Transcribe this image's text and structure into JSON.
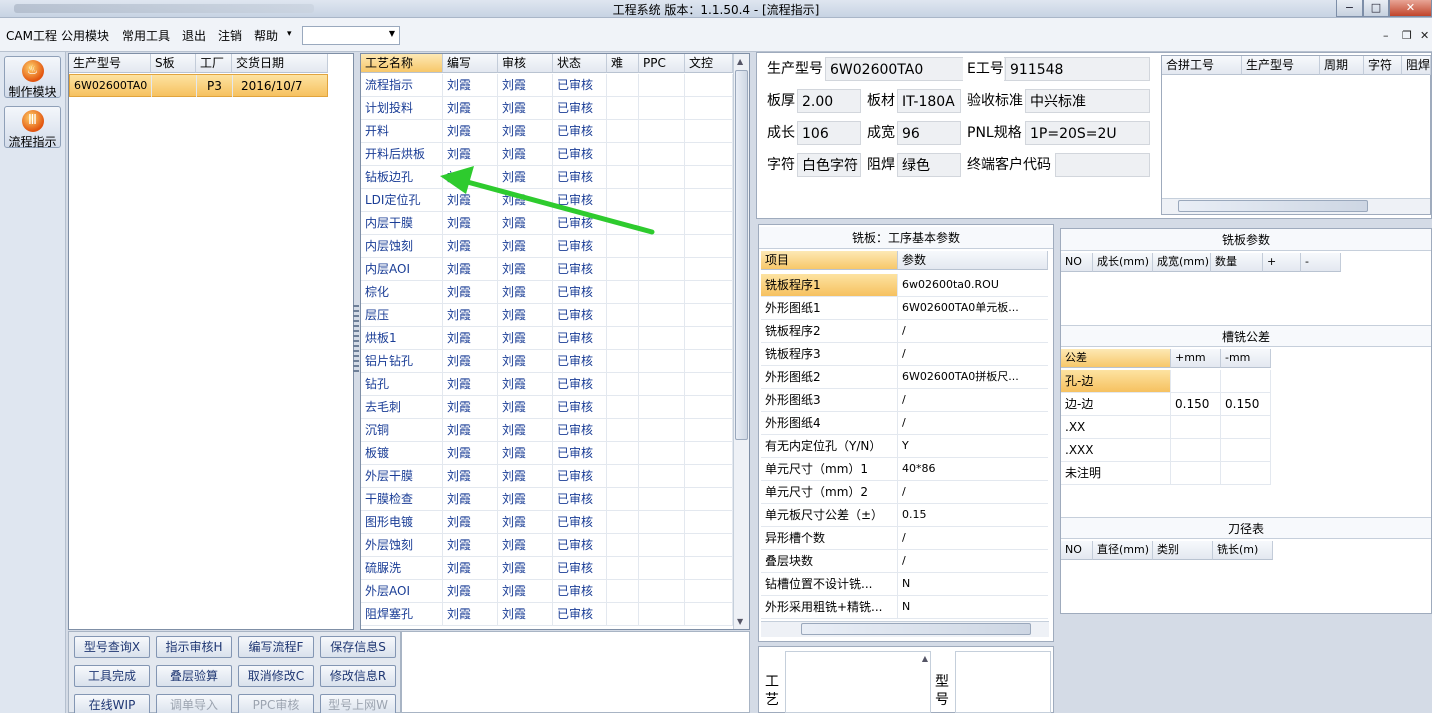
{
  "window": {
    "title": "工程系统    版本：1.1.50.4 - [流程指示]",
    "minimize": "−",
    "maximize": "□",
    "close": "✕"
  },
  "menu": {
    "items": [
      "CAM工程",
      "公用模块",
      "常用工具",
      "退出",
      "注销",
      "帮助"
    ],
    "arrow": "▾",
    "combo_value": "",
    "combo_arrow": "▼",
    "mdi": {
      "minimize": "–",
      "restore": "❐",
      "close": "✕"
    }
  },
  "sidebar": {
    "buttons": [
      {
        "label": "制作模块",
        "icon": "flame-icon",
        "glyph": "♨"
      },
      {
        "label": "流程指示",
        "icon": "chart-icon",
        "glyph": "Ⅲ"
      }
    ]
  },
  "orders": {
    "columns": [
      "生产型号",
      "S板",
      "工厂",
      "交货日期"
    ],
    "rows": [
      {
        "model": "6W02600TA0",
        "s": "",
        "factory": "P3",
        "date": "2016/10/7"
      }
    ]
  },
  "process": {
    "columns": [
      "工艺名称",
      "编写",
      "审核",
      "状态",
      "难",
      "PPC",
      "文控"
    ],
    "rows": [
      [
        "流程指示",
        "刘霞",
        "刘霞",
        "已审核"
      ],
      [
        "计划投料",
        "刘霞",
        "刘霞",
        "已审核"
      ],
      [
        "开料",
        "刘霞",
        "刘霞",
        "已审核"
      ],
      [
        "开料后烘板",
        "刘霞",
        "刘霞",
        "已审核"
      ],
      [
        "钻板边孔",
        "刘霞",
        "刘霞",
        "已审核"
      ],
      [
        "LDI定位孔",
        "刘霞",
        "刘霞",
        "已审核"
      ],
      [
        "内层干膜",
        "刘霞",
        "刘霞",
        "已审核"
      ],
      [
        "内层蚀刻",
        "刘霞",
        "刘霞",
        "已审核"
      ],
      [
        "内层AOI",
        "刘霞",
        "刘霞",
        "已审核"
      ],
      [
        "棕化",
        "刘霞",
        "刘霞",
        "已审核"
      ],
      [
        "层压",
        "刘霞",
        "刘霞",
        "已审核"
      ],
      [
        "烘板1",
        "刘霞",
        "刘霞",
        "已审核"
      ],
      [
        "铝片钻孔",
        "刘霞",
        "刘霞",
        "已审核"
      ],
      [
        "钻孔",
        "刘霞",
        "刘霞",
        "已审核"
      ],
      [
        "去毛刺",
        "刘霞",
        "刘霞",
        "已审核"
      ],
      [
        "沉铜",
        "刘霞",
        "刘霞",
        "已审核"
      ],
      [
        "板镀",
        "刘霞",
        "刘霞",
        "已审核"
      ],
      [
        "外层干膜",
        "刘霞",
        "刘霞",
        "已审核"
      ],
      [
        "干膜检查",
        "刘霞",
        "刘霞",
        "已审核"
      ],
      [
        "图形电镀",
        "刘霞",
        "刘霞",
        "已审核"
      ],
      [
        "外层蚀刻",
        "刘霞",
        "刘霞",
        "已审核"
      ],
      [
        "硫脲洗",
        "刘霞",
        "刘霞",
        "已审核"
      ],
      [
        "外层AOI",
        "刘霞",
        "刘霞",
        "已审核"
      ],
      [
        "阻焊塞孔",
        "刘霞",
        "刘霞",
        "已审核"
      ]
    ]
  },
  "actions": [
    [
      {
        "label": "型号查询X",
        "enabled": true
      },
      {
        "label": "指示审核H",
        "enabled": true
      },
      {
        "label": "编写流程F",
        "enabled": true
      },
      {
        "label": "保存信息S",
        "enabled": true
      }
    ],
    [
      {
        "label": "工具完成",
        "enabled": true
      },
      {
        "label": "叠层验算",
        "enabled": true
      },
      {
        "label": "取消修改C",
        "enabled": true
      },
      {
        "label": "修改信息R",
        "enabled": true
      }
    ],
    [
      {
        "label": "在线WIP",
        "enabled": true
      },
      {
        "label": "调单导入",
        "enabled": false
      },
      {
        "label": "PPC审核",
        "enabled": false
      },
      {
        "label": "型号上网W",
        "enabled": false
      }
    ]
  ],
  "info": {
    "model_label": "生产型号",
    "model_value": "6W02600TA0",
    "eno_label": "E工号",
    "eno_value": "911548",
    "thick_label": "板厚",
    "thick_value": "2.00",
    "mat_label": "板材",
    "mat_value": "IT-180A",
    "std_label": "验收标准",
    "std_value": "中兴标准",
    "len_label": "成长",
    "len_value": "106",
    "wid_label": "成宽",
    "wid_value": "96",
    "pnl_label": "PNL规格",
    "pnl_value": "1P=20S=2U",
    "char_label": "字符",
    "char_value": "白色字符",
    "mask_label": "阻焊",
    "mask_value": "绿色",
    "cust_label": "终端客户代码",
    "cust_value": ""
  },
  "merge": {
    "columns": [
      "合拼工号",
      "生产型号",
      "周期",
      "字符",
      "阻焊"
    ]
  },
  "mill": {
    "title": "铣板：工序基本参数",
    "columns": [
      "项目",
      "参数"
    ],
    "rows": [
      [
        "铣板程序1",
        "6w02600ta0.ROU"
      ],
      [
        "外形图纸1",
        "6W02600TA0单元板..."
      ],
      [
        "铣板程序2",
        "/"
      ],
      [
        "铣板程序3",
        "/"
      ],
      [
        "外形图纸2",
        "6W02600TA0拼板尺..."
      ],
      [
        "外形图纸3",
        "/"
      ],
      [
        "外形图纸4",
        "/"
      ],
      [
        "有无内定位孔（Y/N）",
        "Y"
      ],
      [
        "单元尺寸（mm）1",
        "40*86"
      ],
      [
        "单元尺寸（mm）2",
        "/"
      ],
      [
        "单元板尺寸公差（±）",
        "0.15"
      ],
      [
        "异形槽个数",
        "/"
      ],
      [
        "叠层块数",
        "/"
      ],
      [
        "钻槽位置不设计铣...",
        "N"
      ],
      [
        "外形采用粗铣+精铣...",
        "N"
      ]
    ]
  },
  "mill_params": {
    "title": "铣板参数",
    "columns": [
      "NO",
      "成长(mm)",
      "成宽(mm)",
      "数量",
      "+",
      "-"
    ]
  },
  "slot_tol": {
    "title": "槽铣公差",
    "columns": [
      "公差",
      "+mm",
      "-mm"
    ],
    "rows": [
      [
        "孔-边",
        "",
        ""
      ],
      [
        "边-边",
        "0.150",
        "0.150"
      ],
      [
        ".XX",
        "",
        ""
      ],
      [
        ".XXX",
        "",
        ""
      ],
      [
        "未注明",
        "",
        ""
      ]
    ]
  },
  "tools": {
    "title": "刀径表",
    "columns": [
      "NO",
      "直径(mm)",
      "类别",
      "铣长(m)"
    ]
  },
  "bottom": {
    "left_label": "工艺",
    "right_label": "型号"
  }
}
